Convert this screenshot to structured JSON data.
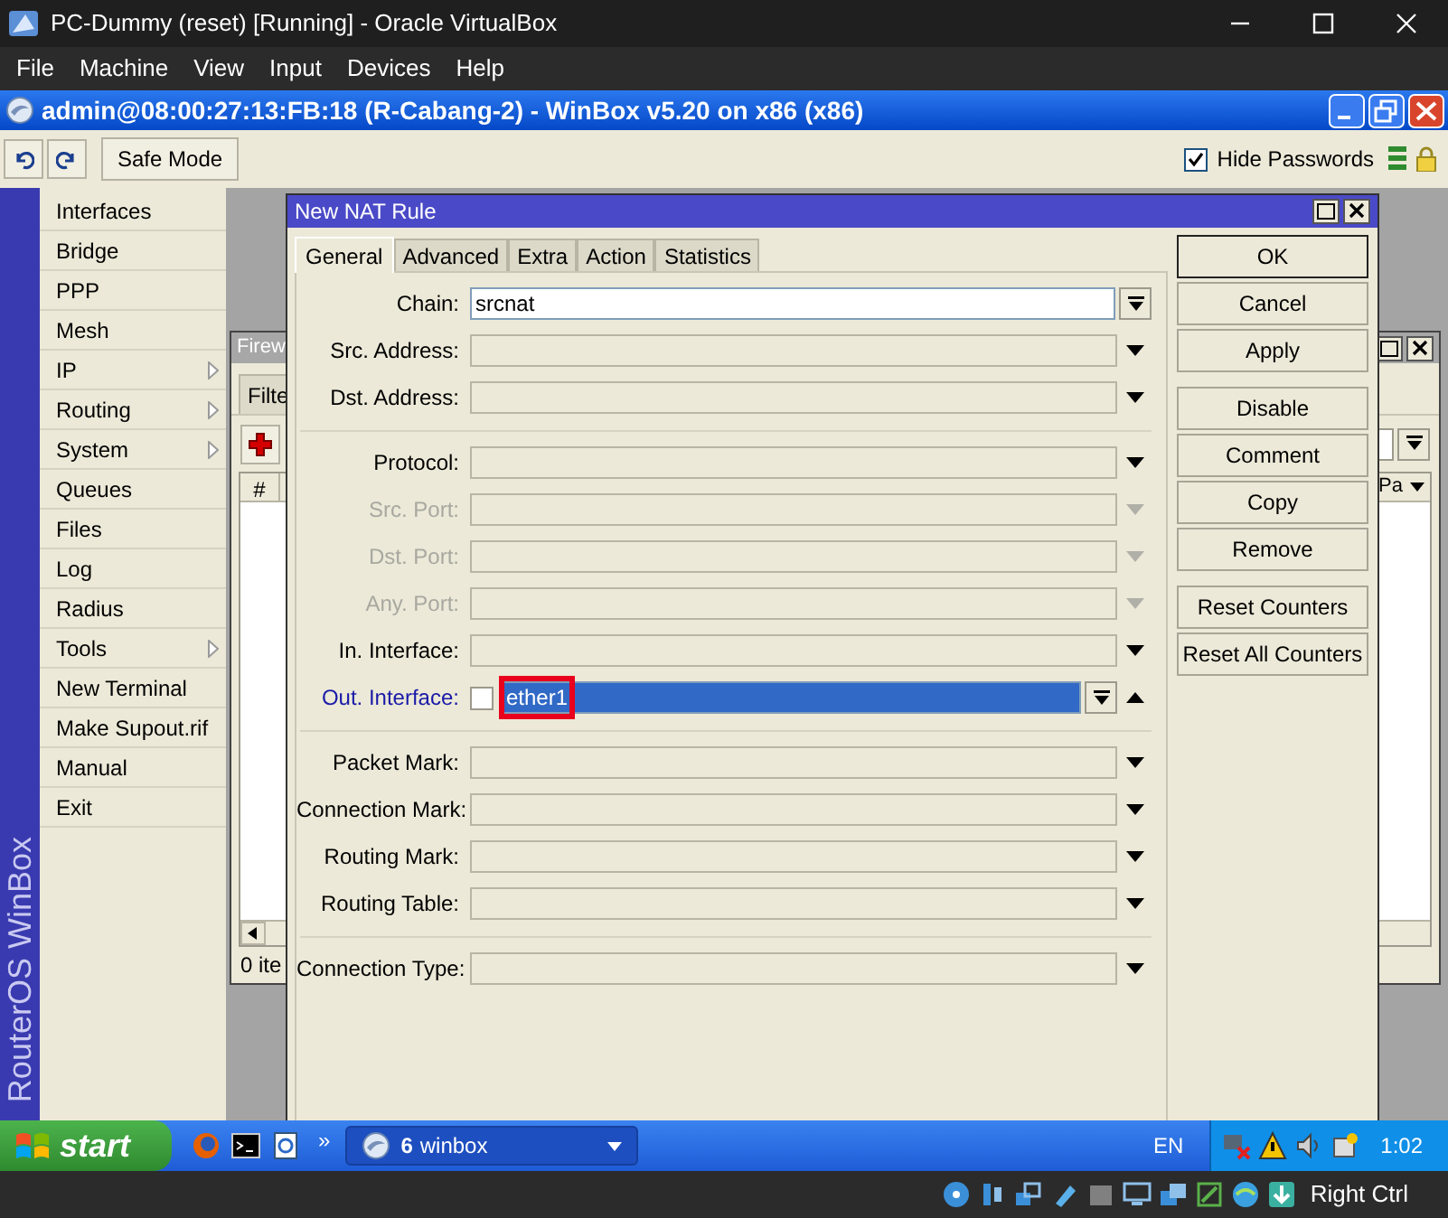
{
  "vbox": {
    "title": "PC-Dummy (reset) [Running] - Oracle VirtualBox",
    "menu": [
      "File",
      "Machine",
      "View",
      "Input",
      "Devices",
      "Help"
    ],
    "host_key": "Right Ctrl"
  },
  "winbox": {
    "title": "admin@08:00:27:13:FB:18 (R-Cabang-2) - WinBox v5.20 on x86 (x86)",
    "safe_mode": "Safe Mode",
    "hide_passwords": {
      "label": "Hide Passwords",
      "checked": true
    },
    "side_label": "RouterOS WinBox",
    "menu": [
      {
        "label": "Interfaces",
        "submenu": false
      },
      {
        "label": "Bridge",
        "submenu": false
      },
      {
        "label": "PPP",
        "submenu": false
      },
      {
        "label": "Mesh",
        "submenu": false
      },
      {
        "label": "IP",
        "submenu": true
      },
      {
        "label": "Routing",
        "submenu": true
      },
      {
        "label": "System",
        "submenu": true
      },
      {
        "label": "Queues",
        "submenu": false
      },
      {
        "label": "Files",
        "submenu": false
      },
      {
        "label": "Log",
        "submenu": false
      },
      {
        "label": "Radius",
        "submenu": false
      },
      {
        "label": "Tools",
        "submenu": true
      },
      {
        "label": "New Terminal",
        "submenu": false
      },
      {
        "label": "Make Supout.rif",
        "submenu": false
      },
      {
        "label": "Manual",
        "submenu": false
      },
      {
        "label": "Exit",
        "submenu": false
      }
    ]
  },
  "firewall_window": {
    "title": "Firew",
    "tab": "Filte",
    "columns": [
      "#",
      "Pa"
    ],
    "status": "0 ite"
  },
  "nat_window": {
    "title": "New NAT Rule",
    "tabs": [
      {
        "label": "General",
        "selected": true
      },
      {
        "label": "Advanced",
        "selected": false
      },
      {
        "label": "Extra",
        "selected": false
      },
      {
        "label": "Action",
        "selected": false
      },
      {
        "label": "Statistics",
        "selected": false
      }
    ],
    "fields": [
      {
        "kind": "field",
        "label": "Chain:",
        "value": "srcnat",
        "disabled": false,
        "active": false,
        "combo": true,
        "arrow": false
      },
      {
        "kind": "field",
        "label": "Src. Address:",
        "disabled": false,
        "active": false,
        "combo": false,
        "arrow": true,
        "expanded": false
      },
      {
        "kind": "field",
        "label": "Dst. Address:",
        "disabled": false,
        "active": false,
        "combo": false,
        "arrow": true,
        "expanded": false
      },
      {
        "kind": "separator"
      },
      {
        "kind": "field",
        "label": "Protocol:",
        "disabled": false,
        "active": false,
        "combo": false,
        "arrow": true,
        "expanded": false
      },
      {
        "kind": "field",
        "label": "Src. Port:",
        "disabled": true,
        "active": false,
        "combo": false,
        "arrow": true,
        "expanded": false
      },
      {
        "kind": "field",
        "label": "Dst. Port:",
        "disabled": true,
        "active": false,
        "combo": false,
        "arrow": true,
        "expanded": false
      },
      {
        "kind": "field",
        "label": "Any. Port:",
        "disabled": true,
        "active": false,
        "combo": false,
        "arrow": true,
        "expanded": false
      },
      {
        "kind": "field",
        "label": "In. Interface:",
        "disabled": false,
        "active": false,
        "combo": false,
        "arrow": true,
        "expanded": false
      },
      {
        "kind": "field",
        "label": "Out. Interface:",
        "value": "ether1",
        "disabled": false,
        "active": true,
        "negate": false,
        "selected": true,
        "annotated": true,
        "combo": true,
        "arrow": true,
        "expanded": true
      },
      {
        "kind": "separator"
      },
      {
        "kind": "field",
        "label": "Packet Mark:",
        "disabled": false,
        "active": false,
        "combo": false,
        "arrow": true,
        "expanded": false
      },
      {
        "kind": "field",
        "label": "Connection Mark:",
        "disabled": false,
        "active": false,
        "combo": false,
        "arrow": true,
        "expanded": false
      },
      {
        "kind": "field",
        "label": "Routing Mark:",
        "disabled": false,
        "active": false,
        "combo": false,
        "arrow": true,
        "expanded": false
      },
      {
        "kind": "field",
        "label": "Routing Table:",
        "disabled": false,
        "active": false,
        "combo": false,
        "arrow": true,
        "expanded": false
      },
      {
        "kind": "separator"
      },
      {
        "kind": "field",
        "label": "Connection Type:",
        "disabled": false,
        "active": false,
        "combo": false,
        "arrow": true,
        "expanded": false
      }
    ],
    "button_groups": [
      [
        {
          "label": "OK",
          "default": true
        },
        {
          "label": "Cancel",
          "default": false
        },
        {
          "label": "Apply",
          "default": false
        }
      ],
      [
        {
          "label": "Disable",
          "default": false
        },
        {
          "label": "Comment",
          "default": false
        },
        {
          "label": "Copy",
          "default": false
        },
        {
          "label": "Remove",
          "default": false
        }
      ],
      [
        {
          "label": "Reset Counters",
          "default": false
        },
        {
          "label": "Reset All Counters",
          "default": false
        }
      ]
    ]
  },
  "taskbar": {
    "start": "start",
    "more": "»",
    "task": {
      "count": "6",
      "label": "winbox"
    },
    "language": "EN",
    "clock": "1:02"
  }
}
